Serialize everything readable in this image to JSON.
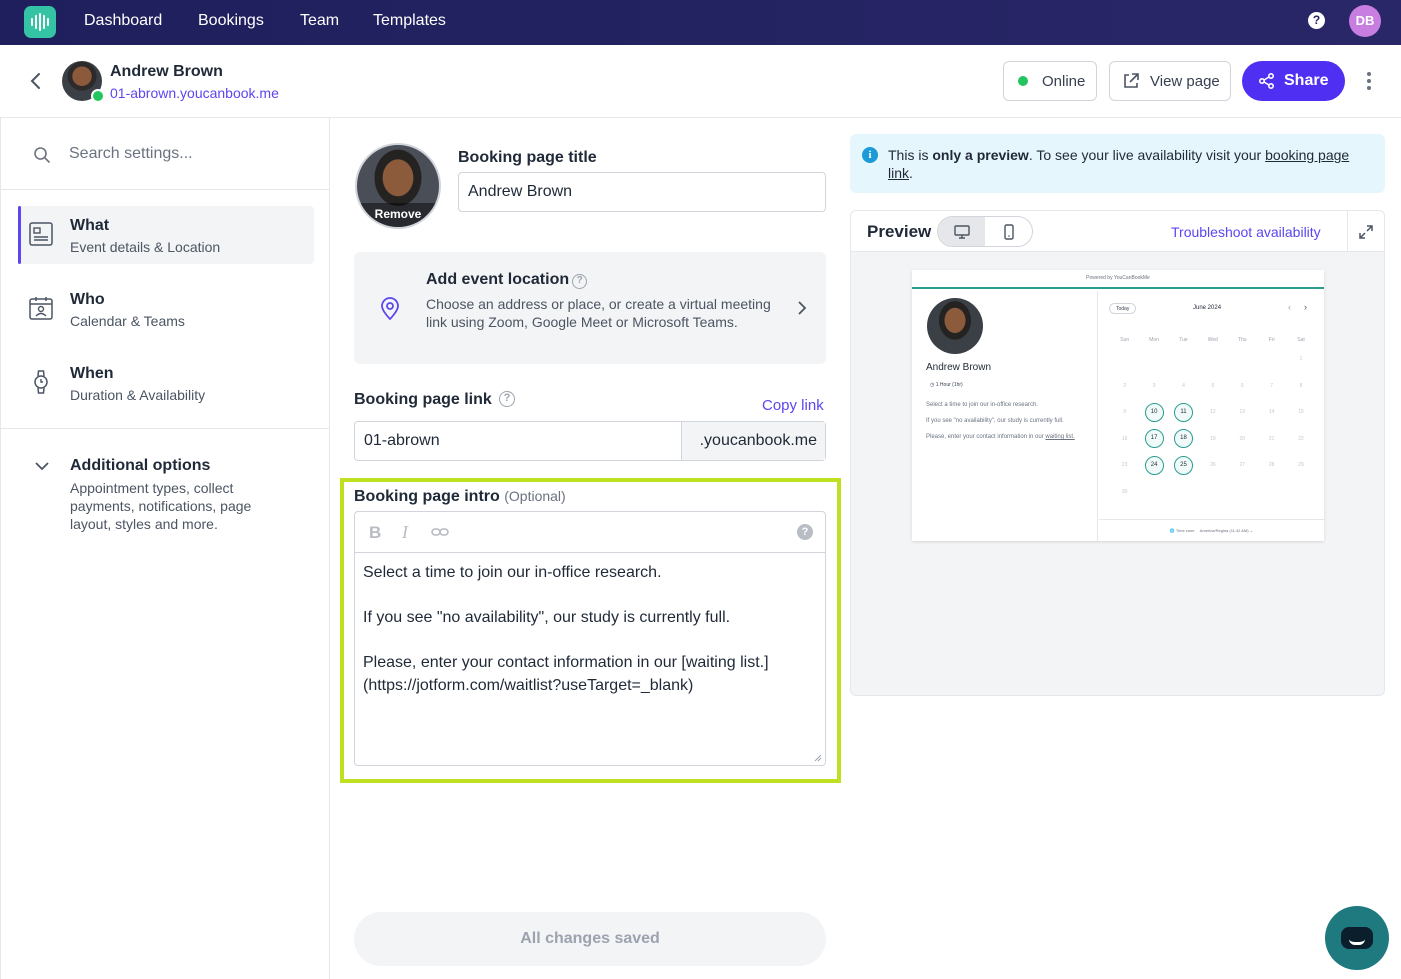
{
  "nav": {
    "items": [
      "Dashboard",
      "Bookings",
      "Team",
      "Templates"
    ],
    "user_initials": "DB",
    "help": "?"
  },
  "header": {
    "name": "Andrew Brown",
    "url": "01-abrown.youcanbook.me",
    "online_label": "Online",
    "view_page_label": "View page",
    "share_label": "Share"
  },
  "sidebar": {
    "search_placeholder": "Search settings...",
    "items": [
      {
        "title": "What",
        "subtitle": "Event details & Location",
        "icon": "document-icon"
      },
      {
        "title": "Who",
        "subtitle": "Calendar & Teams",
        "icon": "calendar-user-icon"
      },
      {
        "title": "When",
        "subtitle": "Duration & Availability",
        "icon": "watch-icon"
      }
    ],
    "additional": {
      "title": "Additional options",
      "subtitle": "Appointment types, collect payments, notifications, page layout, styles and more."
    }
  },
  "form": {
    "photo_remove": "Remove",
    "title_label": "Booking page title",
    "title_value": "Andrew Brown",
    "location_title": "Add event location",
    "location_desc": "Choose an address or place, or create a virtual meeting link using Zoom, Google Meet or Microsoft Teams.",
    "link_label": "Booking page link",
    "copy_link": "Copy link",
    "link_value": "01-abrown",
    "link_suffix": ".youcanbook.me",
    "intro_label": "Booking page intro",
    "intro_optional": "(Optional)",
    "intro_lines": [
      "Select a time to join our in-office research.",
      "If you see \"no availability\", our study is currently full.",
      "Please, enter your contact information in our  [waiting list.](https://jotform.com/waitlist?useTarget=_blank)"
    ],
    "saved_label": "All changes saved"
  },
  "preview": {
    "info_prefix": "This is ",
    "info_bold": "only a preview",
    "info_mid": ". To see your live availability visit your ",
    "info_link": "booking page link",
    "info_end": ".",
    "title": "Preview",
    "troubleshoot": "Troubleshoot availability",
    "mini": {
      "powered": "Powered by YouCanBookMe",
      "name": "Andrew Brown",
      "duration": "1 Hour (1hr)",
      "desc1": "Select a time to join our in-office research.",
      "desc2": "If you see \"no availability\", our study is currently full.",
      "desc3": "Please, enter your contact information in our",
      "desc3_link": "waiting list.",
      "today": "Today",
      "month": "June 2024",
      "weekdays": [
        "Sun",
        "Mon",
        "Tue",
        "Wed",
        "Thu",
        "Fri",
        "Sat"
      ],
      "weeks": [
        [
          "",
          "",
          "",
          "",
          "",
          "",
          "1"
        ],
        [
          "2",
          "3",
          "4",
          "5",
          "6",
          "7",
          "8"
        ],
        [
          "9",
          "10",
          "11",
          "12",
          "13",
          "14",
          "15"
        ],
        [
          "16",
          "17",
          "18",
          "19",
          "20",
          "21",
          "22"
        ],
        [
          "23",
          "24",
          "25",
          "26",
          "27",
          "28",
          "29"
        ],
        [
          "30",
          "",
          "",
          "",
          "",
          "",
          ""
        ]
      ],
      "available": [
        "10",
        "11",
        "17",
        "18",
        "24",
        "25"
      ],
      "timezone_label": "Time zone",
      "timezone": "America/Regina (11:42 AM)"
    }
  },
  "colors": {
    "accent": "#4f2ff2",
    "nav_bg": "#252463",
    "highlight": "#bde021",
    "online": "#22c55e",
    "teal": "#2a9d8f"
  }
}
